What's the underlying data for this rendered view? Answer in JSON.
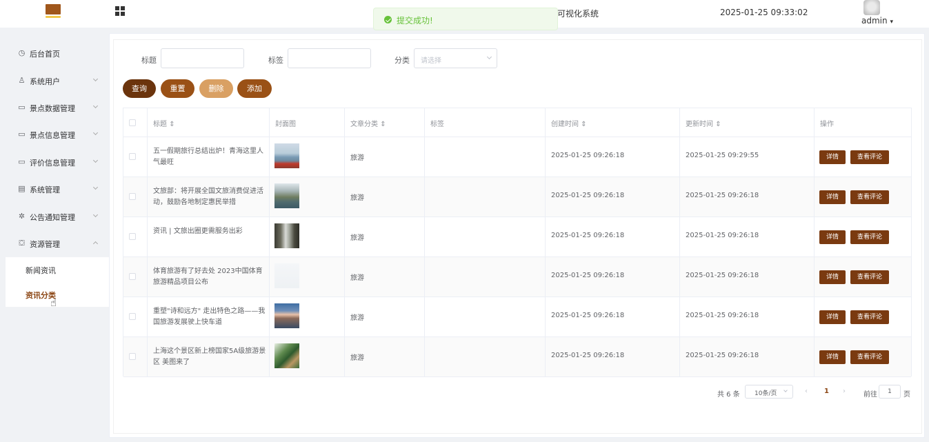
{
  "header": {
    "title": "可视化系统",
    "datetime": "2025-01-25 09:33:02",
    "user": "admin",
    "user_caret": "▾"
  },
  "toast": {
    "text": "提交成功!"
  },
  "sidebar": {
    "items": [
      {
        "label": "后台首页",
        "icon": "clock-icon",
        "glyph": "◷",
        "expandable": false
      },
      {
        "label": "系统用户",
        "icon": "user-icon",
        "glyph": "♙",
        "expandable": true
      },
      {
        "label": "景点数据管理",
        "icon": "chart-icon",
        "glyph": "▭",
        "expandable": true
      },
      {
        "label": "景点信息管理",
        "icon": "chart-icon",
        "glyph": "▭",
        "expandable": true
      },
      {
        "label": "评价信息管理",
        "icon": "chart-icon",
        "glyph": "▭",
        "expandable": true
      },
      {
        "label": "系统管理",
        "icon": "folder-icon",
        "glyph": "▤",
        "expandable": true
      },
      {
        "label": "公告通知管理",
        "icon": "loading-icon",
        "glyph": "✲",
        "expandable": true
      },
      {
        "label": "资源管理",
        "icon": "box-icon",
        "glyph": "⛋",
        "expandable": true,
        "open": true
      }
    ],
    "submenu": [
      {
        "label": "新闻资讯",
        "active": false
      },
      {
        "label": "资讯分类",
        "active": true
      }
    ]
  },
  "filters": {
    "title_label": "标题",
    "title_value": "",
    "tag_label": "标签",
    "tag_value": "",
    "category_label": "分类",
    "category_placeholder": "请选择"
  },
  "buttons": {
    "query": "查询",
    "reset": "重置",
    "delete": "删除",
    "add": "添加"
  },
  "colors": {
    "query": "#6b340d",
    "reset": "#9a5116",
    "delete": "#d9a063",
    "add": "#9a5116",
    "action": "#7a3a10",
    "accent": "#8b4513"
  },
  "table": {
    "headers": {
      "title": "标题",
      "cover": "封面图",
      "category": "文章分类",
      "tags": "标签",
      "created": "创建时间",
      "updated": "更新时间",
      "actions": "操作"
    },
    "sort_glyph": "⇕",
    "detail_label": "详情",
    "comments_label": "查看评论",
    "rows": [
      {
        "title": "五一假期旅行总结出炉！青海这里人气最旺",
        "cover": "lake-photo",
        "category": "旅游",
        "tags": "",
        "created": "2025-01-25 09:26:18",
        "updated": "2025-01-25 09:29:55"
      },
      {
        "title": "文旅部：将开展全国文旅消费促进活动，鼓励各地制定惠民举措",
        "cover": "mountain-lake-photo",
        "category": "旅游",
        "tags": "",
        "created": "2025-01-25 09:26:18",
        "updated": "2025-01-25 09:26:18"
      },
      {
        "title": "资讯 | 文旅出圈更需服务出彩",
        "cover": "cliff-photo",
        "category": "旅游",
        "tags": "",
        "created": "2025-01-25 09:26:18",
        "updated": "2025-01-25 09:26:18"
      },
      {
        "title": "体育旅游有了好去处 2023中国体育旅游精品项目公布",
        "cover": "blank-photo",
        "category": "旅游",
        "tags": "",
        "created": "2025-01-25 09:26:18",
        "updated": "2025-01-25 09:26:18"
      },
      {
        "title": "重塑\"诗和远方\" 走出特色之路——我国旅游发展驶上快车道",
        "cover": "snow-mountain-photo",
        "category": "旅游",
        "tags": "",
        "created": "2025-01-25 09:26:18",
        "updated": "2025-01-25 09:26:18"
      },
      {
        "title": "上海这个景区新上榜国家5A级旅游景区 美图来了",
        "cover": "garden-photo",
        "category": "旅游",
        "tags": "",
        "created": "2025-01-25 09:26:18",
        "updated": "2025-01-25 09:26:18"
      }
    ]
  },
  "pagination": {
    "total": "共 6 条",
    "page_size": "10条/页",
    "prev": "‹",
    "current": "1",
    "next": "›",
    "goto_label": "前往",
    "goto_value": "1",
    "page_suffix": "页"
  }
}
